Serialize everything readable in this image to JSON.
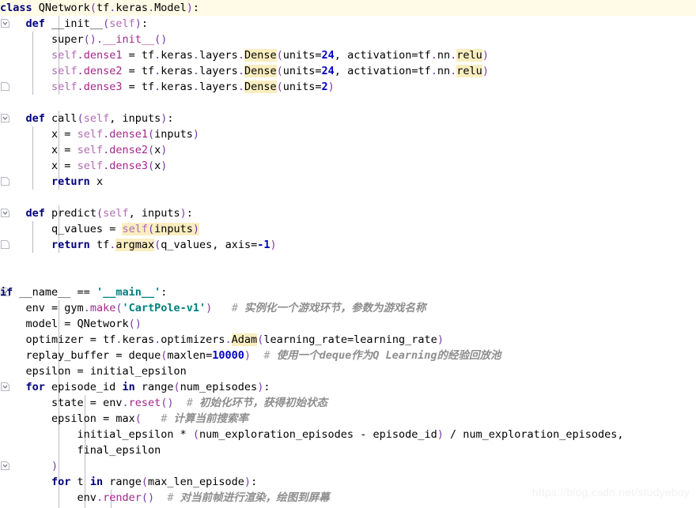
{
  "editor": {
    "language": "Python",
    "current_line_index": 0,
    "watermark": "https://blog.csdn.net/studyeboy",
    "colors": {
      "background": "#ffffff",
      "current_line": "#fffbe6",
      "occurrence_highlight": "#faeec0",
      "keyword": "#00007f",
      "string": "#008080",
      "number": "#0000c0",
      "self": "#b06ab3",
      "attribute": "#a3268a",
      "comment": "#9c9c9c",
      "punctuation": "#7a3ba8",
      "indent_guide": "#b9b9c9",
      "watermark": "#f2f2f2"
    }
  },
  "highlighted_tokens": [
    "Dense",
    "relu",
    "self(inputs)",
    "argmax",
    "Adam"
  ],
  "code": {
    "lines": [
      "class QNetwork(tf.keras.Model):",
      "    def __init__(self):",
      "        super().__init__()",
      "        self.dense1 = tf.keras.layers.Dense(units=24, activation=tf.nn.relu)",
      "        self.dense2 = tf.keras.layers.Dense(units=24, activation=tf.nn.relu)",
      "        self.dense3 = tf.keras.layers.Dense(units=2)",
      "",
      "    def call(self, inputs):",
      "        x = self.dense1(inputs)",
      "        x = self.dense2(x)",
      "        x = self.dense3(x)",
      "        return x",
      "",
      "    def predict(self, inputs):",
      "        q_values = self(inputs)",
      "        return tf.argmax(q_values, axis=-1)",
      "",
      "",
      "if __name__ == '__main__':",
      "    env = gym.make('CartPole-v1')   # 实例化一个游戏环节，参数为游戏名称",
      "    model = QNetwork()",
      "    optimizer = tf.keras.optimizers.Adam(learning_rate=learning_rate)",
      "    replay_buffer = deque(maxlen=10000)   # 使用一个deque作为Q Learning的经验回放池",
      "    epsilon = initial_epsilon",
      "    for episode_id in range(num_episodes):",
      "        state = env.reset()   # 初始化环节，获得初始状态",
      "        epsilon = max(   # 计算当前搜索率",
      "            initial_epsilon * (num_exploration_episodes - episode_id) / num_exploration_episodes,",
      "            final_epsilon",
      "        )",
      "        for t in range(max_len_episode):",
      "            env.render()   # 对当前帧进行渲染，绘图到屏幕"
    ],
    "comments": {
      "make_env": "实例化一个游戏环节，参数为游戏名称",
      "replay_buffer": "使用一个deque作为Q Learning的经验回放池",
      "reset": "初始化环节，获得初始状态",
      "epsilon": "计算当前搜索率",
      "render": "对当前帧进行渲染，绘图到屏幕"
    },
    "identifiers": {
      "class_name": "QNetwork",
      "base_class": "tf.keras.Model",
      "methods": [
        "__init__",
        "call",
        "predict"
      ],
      "layers": [
        "dense1",
        "dense2",
        "dense3"
      ],
      "dense_units": [
        24,
        24,
        2
      ],
      "activation": "tf.nn.relu",
      "env_name": "CartPole-v1",
      "optimizer": "Adam",
      "replay_maxlen": 10000,
      "main_guard": "__main__"
    }
  },
  "gutter": {
    "markers": [
      {
        "type": "fold-open",
        "line": 0
      },
      {
        "type": "fold-open",
        "line": 1
      },
      {
        "type": "fold-end",
        "line": 5
      },
      {
        "type": "fold-open",
        "line": 7
      },
      {
        "type": "fold-end",
        "line": 11
      },
      {
        "type": "fold-open",
        "line": 13
      },
      {
        "type": "fold-end",
        "line": 15
      },
      {
        "type": "fold-open",
        "line": 18
      },
      {
        "type": "fold-open",
        "line": 24
      },
      {
        "type": "fold-end",
        "line": 28
      },
      {
        "type": "fold-open",
        "line": 30
      }
    ]
  }
}
